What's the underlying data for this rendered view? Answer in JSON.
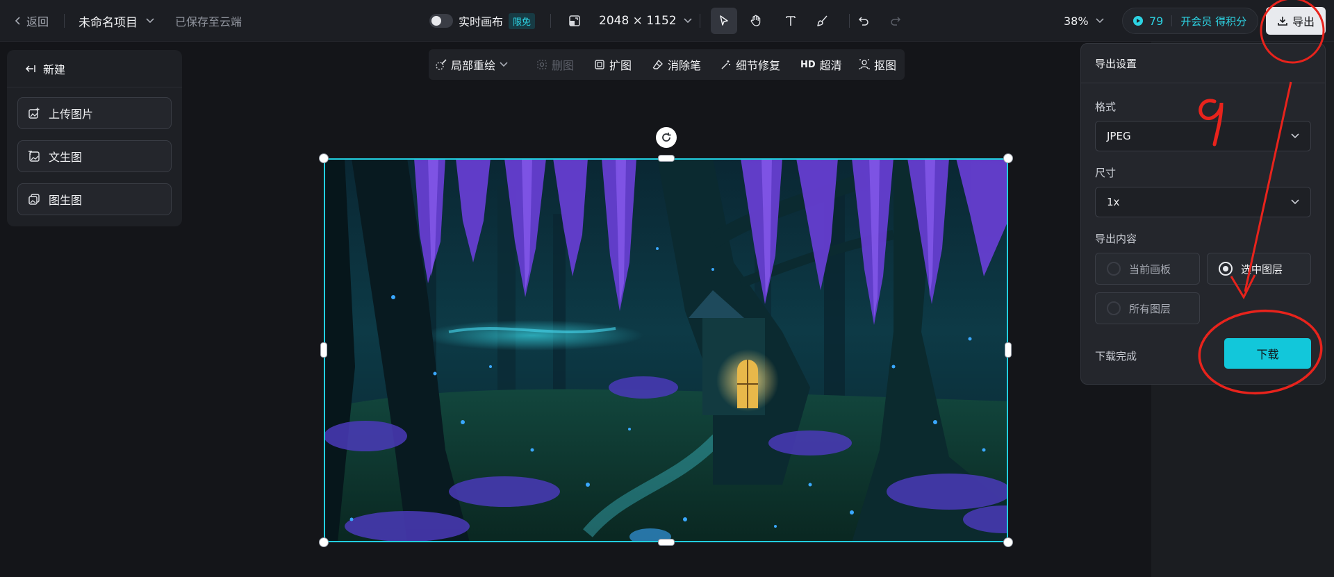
{
  "topbar": {
    "back_label": "返回",
    "project_name": "未命名项目",
    "saved_status": "已保存至云端",
    "realtime_label": "实时画布",
    "realtime_badge": "限免",
    "canvas_size": "2048 × 1152",
    "zoom": "38%",
    "points": "79",
    "member_cta": "开会员 得积分",
    "export_label": "导出"
  },
  "tools": [
    "select-tool",
    "hand-tool",
    "text-tool",
    "brush-tool",
    "undo",
    "redo"
  ],
  "left_panel": {
    "title": "新建",
    "items": [
      "上传图片",
      "文生图",
      "图生图"
    ]
  },
  "float_toolbar": {
    "items": [
      "局部重绘",
      "删图",
      "扩图",
      "消除笔",
      "细节修复",
      "超清",
      "抠图"
    ],
    "hd_prefix": "HD"
  },
  "export_panel": {
    "title": "导出设置",
    "format_label": "格式",
    "format_value": "JPEG",
    "size_label": "尺寸",
    "size_value": "1x",
    "content_label": "导出内容",
    "options": [
      "当前画板",
      "选中图层",
      "所有图层"
    ],
    "selected_option": "选中图层",
    "status": "下载完成",
    "download_label": "下载"
  },
  "annotation": {
    "handwritten_number": "9",
    "color": "#e8231c"
  },
  "colors": {
    "accent": "#12c7da",
    "selection": "#22cfe0"
  }
}
